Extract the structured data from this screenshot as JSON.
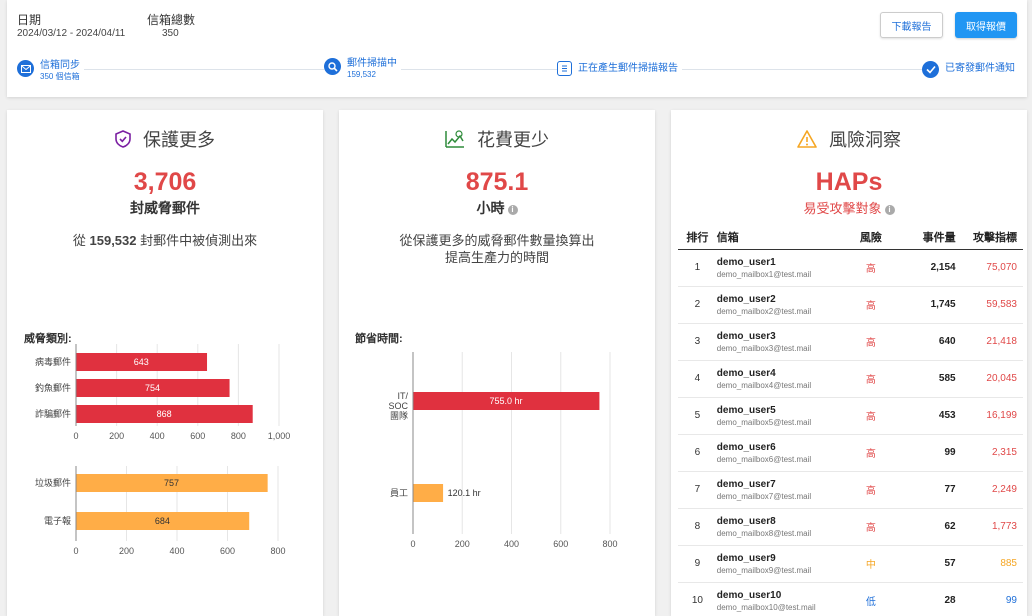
{
  "header": {
    "date_label": "日期",
    "date_value": "2024/03/12 - 2024/04/11",
    "mailbox_label": "信箱總數",
    "mailbox_value": "350",
    "download_button": "下載報告",
    "quote_button": "取得報價",
    "steps": [
      {
        "title": "信箱同步",
        "sub": "350 個信箱",
        "icon": "mail-icon"
      },
      {
        "title": "郵件掃描中",
        "sub": "159,532",
        "icon": "search-icon"
      },
      {
        "title": "正在產生郵件掃描報告",
        "sub": "",
        "icon": "report-icon"
      },
      {
        "title": "已寄發郵件通知",
        "sub": "",
        "icon": "check-icon"
      }
    ]
  },
  "protect": {
    "title": "保護更多",
    "big_number": "3,706",
    "big_unit": "封威脅郵件",
    "desc_prefix": "從",
    "desc_number": "159,532",
    "desc_suffix": "封郵件中被偵測出來",
    "section_label": "威脅類別:"
  },
  "spend": {
    "title": "花費更少",
    "big_number": "875.1",
    "big_unit": "小時",
    "desc_line1": "從保護更多的威脅郵件數量換算出",
    "desc_line2": "提高生產力的時間",
    "section_label": "節省時間:"
  },
  "risk": {
    "title": "風險洞察",
    "big_text": "HAPs",
    "sub_text": "易受攻擊對象",
    "columns": [
      "排行",
      "信箱",
      "風險",
      "事件量",
      "攻擊指標"
    ],
    "rows": [
      {
        "rank": "1",
        "name": "demo_user1",
        "mail": "demo_mailbox1@test.mail",
        "risk": "高",
        "level": "high",
        "events": "2,154",
        "score": "75,070"
      },
      {
        "rank": "2",
        "name": "demo_user2",
        "mail": "demo_mailbox2@test.mail",
        "risk": "高",
        "level": "high",
        "events": "1,745",
        "score": "59,583"
      },
      {
        "rank": "3",
        "name": "demo_user3",
        "mail": "demo_mailbox3@test.mail",
        "risk": "高",
        "level": "high",
        "events": "640",
        "score": "21,418"
      },
      {
        "rank": "4",
        "name": "demo_user4",
        "mail": "demo_mailbox4@test.mail",
        "risk": "高",
        "level": "high",
        "events": "585",
        "score": "20,045"
      },
      {
        "rank": "5",
        "name": "demo_user5",
        "mail": "demo_mailbox5@test.mail",
        "risk": "高",
        "level": "high",
        "events": "453",
        "score": "16,199"
      },
      {
        "rank": "6",
        "name": "demo_user6",
        "mail": "demo_mailbox6@test.mail",
        "risk": "高",
        "level": "high",
        "events": "99",
        "score": "2,315"
      },
      {
        "rank": "7",
        "name": "demo_user7",
        "mail": "demo_mailbox7@test.mail",
        "risk": "高",
        "level": "high",
        "events": "77",
        "score": "2,249"
      },
      {
        "rank": "8",
        "name": "demo_user8",
        "mail": "demo_mailbox8@test.mail",
        "risk": "高",
        "level": "high",
        "events": "62",
        "score": "1,773"
      },
      {
        "rank": "9",
        "name": "demo_user9",
        "mail": "demo_mailbox9@test.mail",
        "risk": "中",
        "level": "mid",
        "events": "57",
        "score": "885"
      },
      {
        "rank": "10",
        "name": "demo_user10",
        "mail": "demo_mailbox10@test.mail",
        "risk": "低",
        "level": "low",
        "events": "28",
        "score": "99"
      }
    ]
  },
  "colors": {
    "accent": "#1e6fd9",
    "threat_bar": "#e0313f",
    "spam_bar": "#ffad47",
    "danger_text": "#e04848"
  },
  "chart_data": [
    {
      "type": "bar",
      "orientation": "horizontal",
      "categories": [
        "病毒郵件",
        "釣魚郵件",
        "詐騙郵件"
      ],
      "values": [
        643,
        754,
        868
      ],
      "value_labels": [
        "643",
        "754",
        "868"
      ],
      "xlim": [
        0,
        1000
      ],
      "ticks": [
        "0",
        "200",
        "400",
        "600",
        "800",
        "1,000"
      ],
      "color": "#e0313f"
    },
    {
      "type": "bar",
      "orientation": "horizontal",
      "categories": [
        "垃圾郵件",
        "電子報"
      ],
      "values": [
        757,
        684
      ],
      "value_labels": [
        "757",
        "684"
      ],
      "xlim": [
        0,
        800
      ],
      "ticks": [
        "0",
        "200",
        "400",
        "600",
        "800"
      ],
      "color": "#ffad47"
    },
    {
      "type": "bar",
      "orientation": "horizontal",
      "categories": [
        "IT/ SOC 團隊",
        "員工"
      ],
      "values": [
        755.0,
        120.1
      ],
      "value_labels": [
        "755.0 hr",
        "120.1 hr"
      ],
      "xlim": [
        0,
        800
      ],
      "ticks": [
        "0",
        "200",
        "400",
        "600",
        "800"
      ],
      "colors": [
        "#e0313f",
        "#ffad47"
      ]
    }
  ]
}
